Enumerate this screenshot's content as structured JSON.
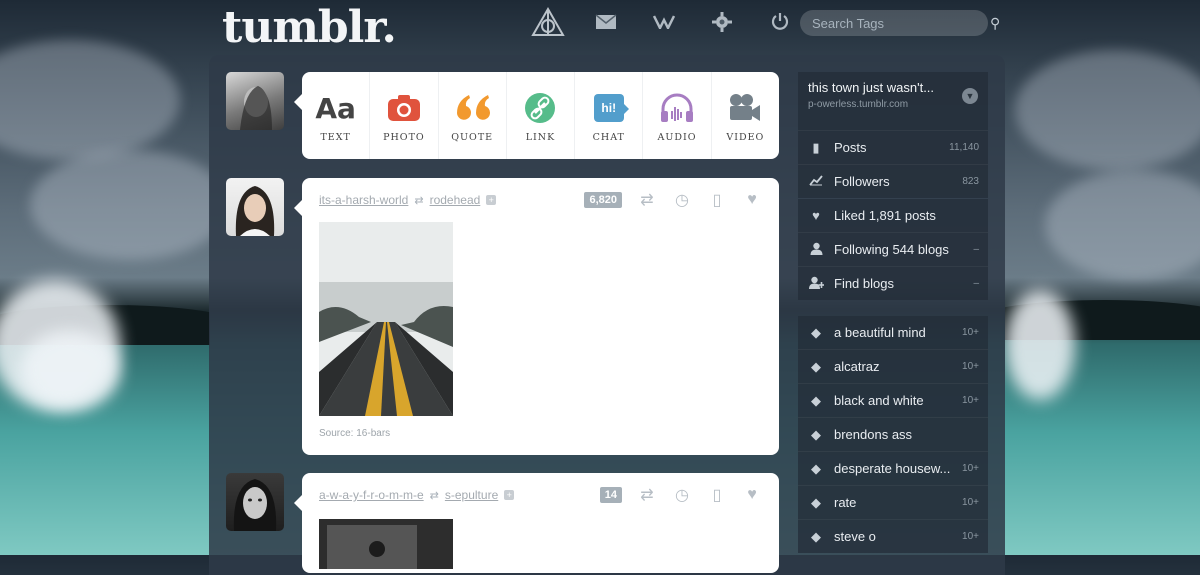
{
  "header": {
    "logo": "tumblr.",
    "nav": [
      "dashboard-icon",
      "mail-icon",
      "activity-icon",
      "gear-icon",
      "power-icon"
    ],
    "search_placeholder": "Search Tags"
  },
  "post_types": [
    {
      "label": "TEXT",
      "icon": "text-icon",
      "color": "#444444"
    },
    {
      "label": "PHOTO",
      "icon": "camera-icon",
      "color": "#e0533d"
    },
    {
      "label": "QUOTE",
      "icon": "quote-icon",
      "color": "#f2992e"
    },
    {
      "label": "LINK",
      "icon": "link-icon",
      "color": "#56bc8a"
    },
    {
      "label": "CHAT",
      "icon": "chat-icon",
      "color": "#529ecc"
    },
    {
      "label": "AUDIO",
      "icon": "headphones-icon",
      "color": "#a77dc2"
    },
    {
      "label": "VIDEO",
      "icon": "video-camera-icon",
      "color": "#748089"
    }
  ],
  "text_glyph": "Aa",
  "chat_glyph": "hi!",
  "posts": [
    {
      "reblogger": "its-a-harsh-world",
      "source_blog": "rodehead",
      "notes": "6,820",
      "source": "Source: 16-bars"
    },
    {
      "reblogger": "a-w-a-y-f-r-o-m-m-e",
      "source_blog": "s-epulture",
      "notes": "14"
    }
  ],
  "sidebar": {
    "blog_title": "this town just wasn't...",
    "blog_url": "p-owerless.tumblr.com",
    "stats": [
      {
        "label": "Posts",
        "count": "11,140",
        "icon": "document-icon"
      },
      {
        "label": "Followers",
        "count": "823",
        "icon": "chart-icon"
      }
    ],
    "activity": [
      {
        "label": "Liked 1,891 posts",
        "icon": "heart-icon",
        "suffix": ""
      },
      {
        "label": "Following 544 blogs",
        "icon": "person-icon",
        "suffix": "–"
      },
      {
        "label": "Find blogs",
        "icon": "person-add-icon",
        "suffix": "–"
      }
    ],
    "tags": [
      {
        "label": "a beautiful mind",
        "count": "10+"
      },
      {
        "label": "alcatraz",
        "count": "10+"
      },
      {
        "label": "black and white",
        "count": "10+"
      },
      {
        "label": "brendons ass",
        "count": ""
      },
      {
        "label": "desperate housew...",
        "count": "10+"
      },
      {
        "label": "rate",
        "count": "10+"
      },
      {
        "label": "steve o",
        "count": "10+"
      }
    ]
  },
  "colors": {
    "accent": "#2e3a47",
    "card": "#ffffff",
    "sidebar_text": "#e9edf1"
  }
}
